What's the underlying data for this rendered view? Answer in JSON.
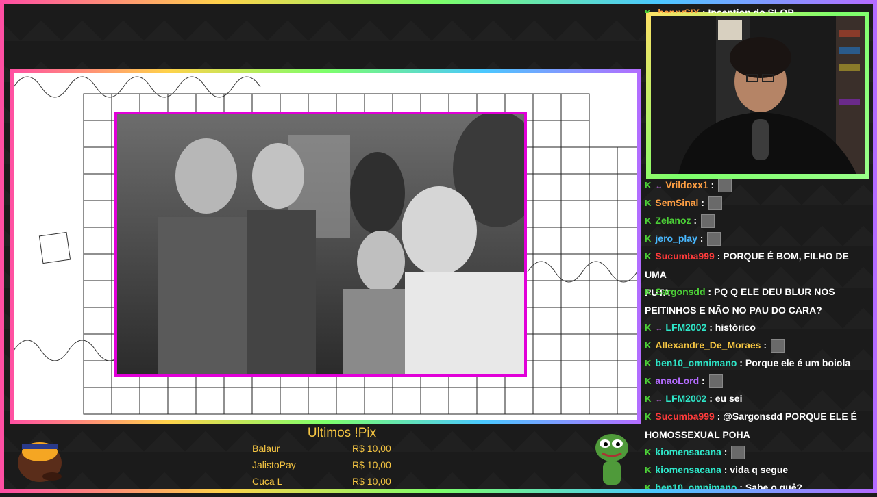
{
  "chat": {
    "top_partial": {
      "user": "henrySIX",
      "text": "Inception do SLOP",
      "color": "#ff9f43"
    },
    "messages": [
      {
        "user": "Vrildoxx1",
        "color": "#ff9f43",
        "mod": true,
        "text": "",
        "emote": true
      },
      {
        "user": "SemSinal",
        "color": "#ff9f43",
        "mod": false,
        "text": "",
        "emote": true
      },
      {
        "user": "Zelanoz",
        "color": "#4cd137",
        "mod": false,
        "text": "",
        "emote": true
      },
      {
        "user": "jero_play",
        "color": "#48b8ff",
        "mod": false,
        "text": "",
        "emote": true
      },
      {
        "user": "Sucumba999",
        "color": "#ff3b3b",
        "mod": false,
        "text": "PORQUE É BOM, FILHO DE UMA",
        "text2": "PUTA"
      },
      {
        "user": "Sargonsdd",
        "color": "#4cd137",
        "mod": false,
        "text": "PQ Q ELE DEU BLUR NOS",
        "text2": "PEITINHOS E NÃO NO PAU DO CARA?"
      },
      {
        "user": "LFM2002",
        "color": "#2ee6c8",
        "mod": true,
        "text": "histórico"
      },
      {
        "user": "Allexandre_De_Moraes",
        "color": "#f5c542",
        "mod": false,
        "text": "",
        "emote": true
      },
      {
        "user": "ben10_omnimano",
        "color": "#2ee6c8",
        "mod": false,
        "text": "Porque ele é um boiola"
      },
      {
        "user": "anaoLord",
        "color": "#b46cff",
        "mod": false,
        "text": "",
        "emote": true
      },
      {
        "user": "LFM2002",
        "color": "#2ee6c8",
        "mod": true,
        "text": "eu sei"
      },
      {
        "user": "Sucumba999",
        "color": "#ff3b3b",
        "mod": false,
        "text": "@Sargonsdd PORQUE ELE É",
        "text2": "HOMOSSEXUAL POHA"
      },
      {
        "user": "kiomensacana",
        "color": "#2ee6c8",
        "mod": false,
        "text": "",
        "emote": true
      },
      {
        "user": "kiomensacana",
        "color": "#2ee6c8",
        "mod": false,
        "text": "vida q segue"
      },
      {
        "user": "ben10_omnimano",
        "color": "#2ee6c8",
        "mod": false,
        "text": "Sabe o quê?"
      }
    ]
  },
  "pix": {
    "title": "Ultimos !Pix",
    "entries": [
      {
        "name": "Balaur",
        "value": "R$ 10,00"
      },
      {
        "name": "JalistoPay",
        "value": "R$ 10,00"
      },
      {
        "name": "Cuca L",
        "value": "R$ 10,00"
      }
    ]
  },
  "colors": {
    "accent_frame": "#e100d8",
    "pix_text": "#f5c542",
    "chat_badge": "#4cd137"
  },
  "icons": {
    "badge": "k-badge-icon",
    "mod": "mod-badge-icon",
    "emote": "emote-icon",
    "pepe": "pepe-sticker",
    "mascot": "mascot-sticker"
  }
}
